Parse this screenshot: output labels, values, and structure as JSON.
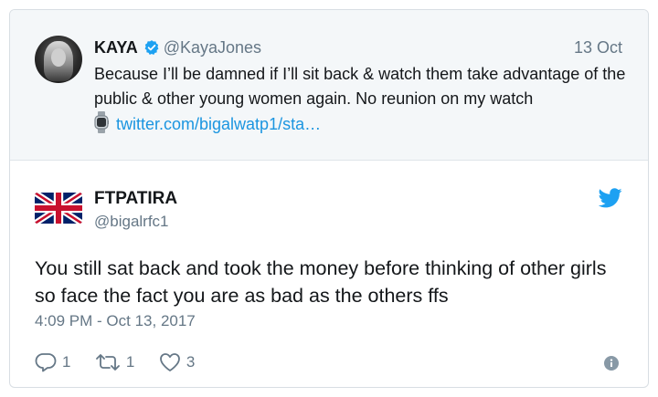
{
  "quoted": {
    "name": "KAYA",
    "handle": "@KayaJones",
    "date": "13 Oct",
    "text": "Because I’ll be damned if I’ll sit back & watch them take advantage of the public & other young women again. No reunion on my watch",
    "link": "twitter.com/bigalwatp1/sta…"
  },
  "tweet": {
    "name": "FTPATIRA",
    "handle": "@bigalrfc1",
    "text": "You still sat back and took the money before thinking of other girls so face the fact you are as bad as the others ffs",
    "timestamp": "4:09 PM - Oct 13, 2017",
    "replies": "1",
    "retweets": "1",
    "likes": "3"
  },
  "colors": {
    "twitter_blue": "#1da1f2",
    "link_blue": "#1b95e0",
    "muted_gray": "#657786",
    "quoted_bg": "#f4f7f9"
  },
  "icons": [
    "verified-badge-icon",
    "watch-emoji-icon",
    "twitter-bird-icon",
    "reply-icon",
    "retweet-icon",
    "like-icon",
    "info-icon"
  ]
}
